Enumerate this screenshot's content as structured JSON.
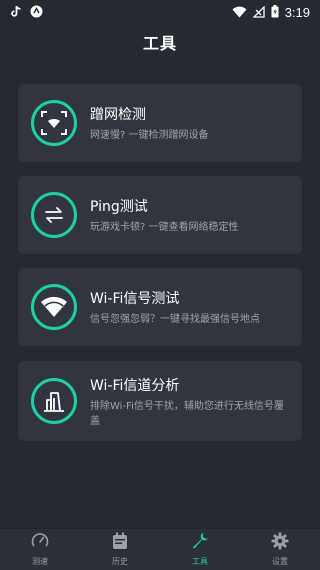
{
  "status_bar": {
    "time": "3:19",
    "left_icons": [
      "tiktok-icon",
      "app-circle-icon"
    ],
    "right_icons": [
      "wifi-icon",
      "no-signal-icon",
      "battery-charging-icon"
    ]
  },
  "header": {
    "title": "工具"
  },
  "tools": [
    {
      "title": "蹭网检测",
      "desc": "网速慢? 一键检测蹭网设备",
      "icon": "scan-face-icon"
    },
    {
      "title": "Ping测试",
      "desc": "玩游戏卡顿? 一键查看网络稳定性",
      "icon": "swap-arrows-icon"
    },
    {
      "title": "Wi-Fi信号测试",
      "desc": "信号忽强忽弱？一键寻找最强信号地点",
      "icon": "wifi-signal-icon"
    },
    {
      "title": "Wi-Fi信道分析",
      "desc": "排除Wi-Fi信号干扰，辅助您进行无线信号覆盖",
      "icon": "channel-bars-icon"
    }
  ],
  "bottom_nav": [
    {
      "label": "测速",
      "icon": "speedometer-icon",
      "active": false
    },
    {
      "label": "历史",
      "icon": "calendar-icon",
      "active": false
    },
    {
      "label": "工具",
      "icon": "wrench-icon",
      "active": true
    },
    {
      "label": "设置",
      "icon": "gear-icon",
      "active": false
    }
  ],
  "colors": {
    "background": "#252a31",
    "card": "#30353e",
    "accent": "#1ed1a2",
    "nav_inactive": "#9aa0a8"
  }
}
